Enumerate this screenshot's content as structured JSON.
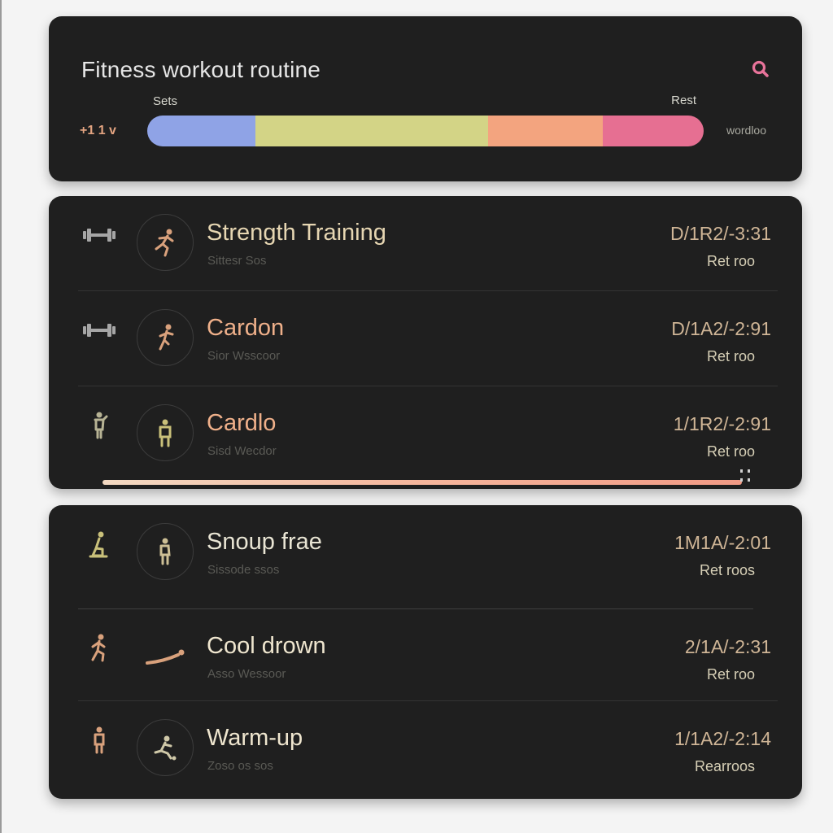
{
  "header": {
    "title": "Fitness workout routine",
    "bar_label_start": "Sets",
    "bar_label_end": "Rest",
    "bar_left_text": "+1 1 v",
    "bar_right_text": "wordloo",
    "segments": [
      {
        "color": "#8fa3e6",
        "fraction": 0.195
      },
      {
        "color": "#d3d486",
        "fraction": 0.418
      },
      {
        "color": "#f3a47f",
        "fraction": 0.205
      },
      {
        "color": "#e66f92",
        "fraction": 0.182
      }
    ]
  },
  "list1": {
    "rows": [
      {
        "name": "Strength Training",
        "sub": "Sittesr Sos",
        "time": "D/1R2/-3:31",
        "rest": "Ret roo",
        "name_color": "#e6d6b2"
      },
      {
        "name": "Cardon",
        "sub": "Sior Wsscoor",
        "time": "D/1A2/-2:91",
        "rest": "Ret roo",
        "name_color": "#efb08a"
      },
      {
        "name": "Cardlo",
        "sub": "Sisd Wecdor",
        "time": "1/1R2/-2:91",
        "rest": "Ret roo",
        "name_color": "#efb08a"
      }
    ]
  },
  "list2": {
    "rows": [
      {
        "name": "Snoup frae",
        "sub": "Sissode ssos",
        "time": "1M1A/-2:01",
        "rest": "Ret roos",
        "name_color": "#e9e5d4"
      },
      {
        "name": "Cool drown",
        "sub": "Asso Wessoor",
        "time": "2/1A/-2:31",
        "rest": "Ret roo",
        "name_color": "#efe6cf"
      },
      {
        "name": "Warm-up",
        "sub": "Zoso os sos",
        "time": "1/1A2/-2:14",
        "rest": "Rearroos",
        "name_color": "#efe6cf"
      }
    ]
  },
  "colors": {
    "accent_pink": "#e8739a",
    "card_bg": "#1f1f1f",
    "icon_tan": "#d9a17c",
    "icon_gray": "#a6a6a6",
    "icon_olive": "#b7b394"
  },
  "icons": {
    "search": "search-icon",
    "dumbbell": "dumbbell-icon",
    "runner": "running-figure-icon",
    "stand": "standing-figure-icon",
    "lying": "lying-stretch-icon",
    "squat": "squat-figure-icon"
  }
}
